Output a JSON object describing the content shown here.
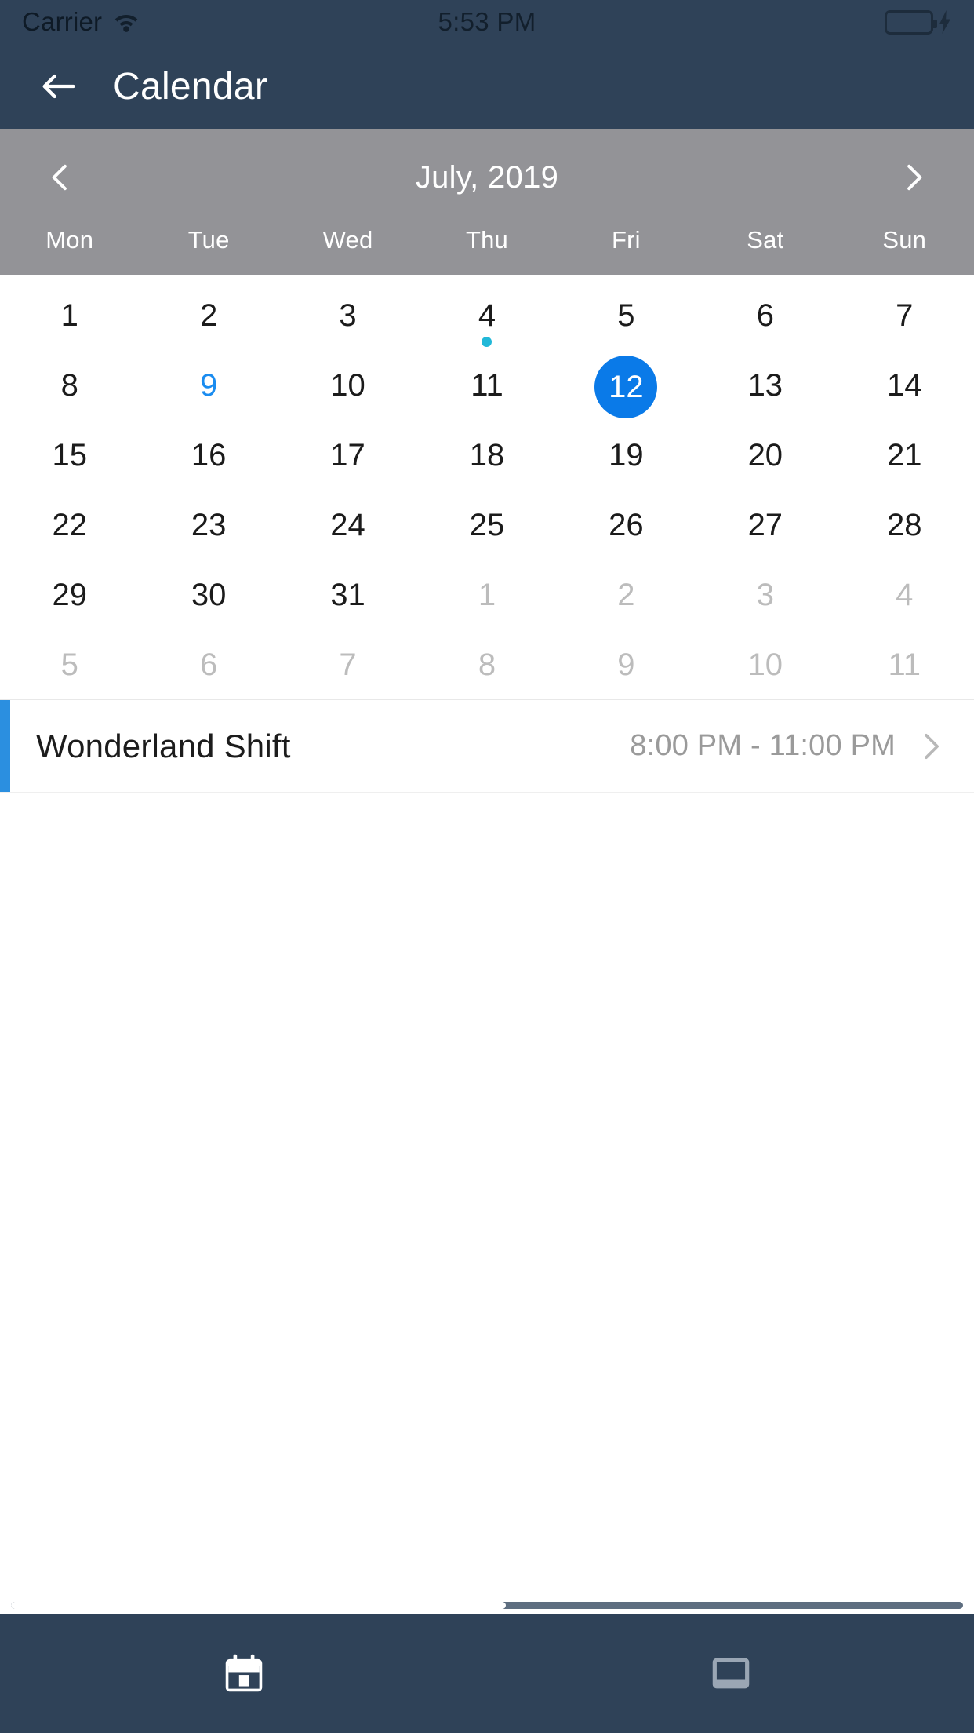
{
  "status_bar": {
    "carrier": "Carrier",
    "time": "5:53 PM",
    "wifi_icon": "wifi-icon",
    "battery_icon": "battery-icon",
    "charging_icon": "lightning-bolt-icon",
    "battery_color": "#3ddc55"
  },
  "nav_bar": {
    "back_icon": "arrow-left-icon",
    "title": "Calendar",
    "background": "#2f4258"
  },
  "calendar_header": {
    "prev_icon": "chevron-left-icon",
    "next_icon": "chevron-right-icon",
    "month_label": "July, 2019",
    "background": "#939397",
    "weekdays": [
      "Mon",
      "Tue",
      "Wed",
      "Thu",
      "Fri",
      "Sat",
      "Sun"
    ]
  },
  "calendar": {
    "selected_color": "#0a7ae8",
    "today_color": "#1a8cf0",
    "event_dot_color": "#22b8d8",
    "weeks": [
      [
        {
          "label": "1",
          "state": "normal",
          "dot": false
        },
        {
          "label": "2",
          "state": "normal",
          "dot": false
        },
        {
          "label": "3",
          "state": "normal",
          "dot": false
        },
        {
          "label": "4",
          "state": "normal",
          "dot": true
        },
        {
          "label": "5",
          "state": "normal",
          "dot": false
        },
        {
          "label": "6",
          "state": "normal",
          "dot": false
        },
        {
          "label": "7",
          "state": "normal",
          "dot": false
        }
      ],
      [
        {
          "label": "8",
          "state": "normal",
          "dot": false
        },
        {
          "label": "9",
          "state": "today",
          "dot": false
        },
        {
          "label": "10",
          "state": "normal",
          "dot": false
        },
        {
          "label": "11",
          "state": "normal",
          "dot": false
        },
        {
          "label": "12",
          "state": "selected",
          "dot": true
        },
        {
          "label": "13",
          "state": "normal",
          "dot": false
        },
        {
          "label": "14",
          "state": "normal",
          "dot": false
        }
      ],
      [
        {
          "label": "15",
          "state": "normal",
          "dot": false
        },
        {
          "label": "16",
          "state": "normal",
          "dot": false
        },
        {
          "label": "17",
          "state": "normal",
          "dot": false
        },
        {
          "label": "18",
          "state": "normal",
          "dot": false
        },
        {
          "label": "19",
          "state": "normal",
          "dot": false
        },
        {
          "label": "20",
          "state": "normal",
          "dot": false
        },
        {
          "label": "21",
          "state": "normal",
          "dot": false
        }
      ],
      [
        {
          "label": "22",
          "state": "normal",
          "dot": false
        },
        {
          "label": "23",
          "state": "normal",
          "dot": false
        },
        {
          "label": "24",
          "state": "normal",
          "dot": false
        },
        {
          "label": "25",
          "state": "normal",
          "dot": false
        },
        {
          "label": "26",
          "state": "normal",
          "dot": false
        },
        {
          "label": "27",
          "state": "normal",
          "dot": false
        },
        {
          "label": "28",
          "state": "normal",
          "dot": false
        }
      ],
      [
        {
          "label": "29",
          "state": "normal",
          "dot": false
        },
        {
          "label": "30",
          "state": "normal",
          "dot": false
        },
        {
          "label": "31",
          "state": "normal",
          "dot": false
        },
        {
          "label": "1",
          "state": "muted",
          "dot": false
        },
        {
          "label": "2",
          "state": "muted",
          "dot": false
        },
        {
          "label": "3",
          "state": "muted",
          "dot": false
        },
        {
          "label": "4",
          "state": "muted",
          "dot": false
        }
      ],
      [
        {
          "label": "5",
          "state": "muted",
          "dot": false
        },
        {
          "label": "6",
          "state": "muted",
          "dot": false
        },
        {
          "label": "7",
          "state": "muted",
          "dot": false
        },
        {
          "label": "8",
          "state": "muted",
          "dot": false
        },
        {
          "label": "9",
          "state": "muted",
          "dot": false
        },
        {
          "label": "10",
          "state": "muted",
          "dot": false
        },
        {
          "label": "11",
          "state": "muted",
          "dot": false
        }
      ]
    ]
  },
  "events": [
    {
      "title": "Wonderland Shift",
      "time": "8:00 PM - 11:00 PM",
      "accent_color": "#2b8fe0",
      "chevron_icon": "chevron-right-icon"
    }
  ],
  "tab_bar": {
    "background": "#2f4258",
    "items": [
      {
        "icon": "calendar-icon",
        "active": true
      },
      {
        "icon": "inbox-tray-icon",
        "active": false
      }
    ]
  }
}
